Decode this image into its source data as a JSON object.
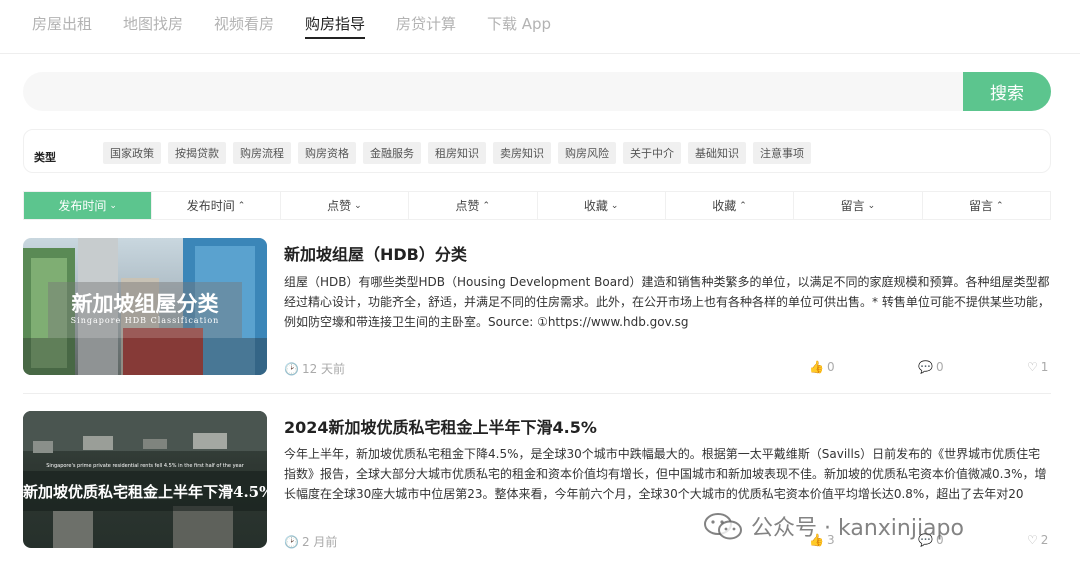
{
  "nav": {
    "items": [
      {
        "label": "房屋出租"
      },
      {
        "label": "地图找房"
      },
      {
        "label": "视频看房"
      },
      {
        "label": "购房指导"
      },
      {
        "label": "房贷计算"
      },
      {
        "label": "下载 App"
      }
    ],
    "active_index": 3
  },
  "search": {
    "placeholder": "",
    "value": "",
    "button_label": "搜索"
  },
  "filter": {
    "type_label": "类型",
    "tags": [
      "国家政策",
      "按揭贷款",
      "购房流程",
      "购房资格",
      "金融服务",
      "租房知识",
      "卖房知识",
      "购房风险",
      "关于中介",
      "基础知识",
      "注意事项"
    ]
  },
  "sort": {
    "tabs": [
      {
        "label": "发布时间",
        "dir": "⌄"
      },
      {
        "label": "发布时间",
        "dir": "⌃"
      },
      {
        "label": "点赞",
        "dir": "⌄"
      },
      {
        "label": "点赞",
        "dir": "⌃"
      },
      {
        "label": "收藏",
        "dir": "⌄"
      },
      {
        "label": "收藏",
        "dir": "⌃"
      },
      {
        "label": "留言",
        "dir": "⌄"
      },
      {
        "label": "留言",
        "dir": "⌃"
      }
    ]
  },
  "articles": [
    {
      "title": "新加坡组屋（HDB）分类",
      "excerpt": "组屋（HDB）有哪些类型HDB（Housing Development Board）建造和销售种类繁多的单位，以满足不同的家庭规模和预算。各种组屋类型都经过精心设计，功能齐全，舒适，并满足不同的住房需求。此外，在公开市场上也有各种各样的单位可供出售。* 转售单位可能不提供某些功能，例如防空壕和带连接卫生间的主卧室。Source: ①https://www.hdb.gov.sg",
      "time": "12 天前",
      "likes": "0",
      "comments": "0",
      "favorites": "1",
      "thumb_title": "新加坡组屋分类",
      "thumb_subtitle": "Singapore HDB Classification"
    },
    {
      "title": "2024新加坡优质私宅租金上半年下滑4.5%",
      "excerpt": "今年上半年，新加坡优质私宅租金下降4.5%，是全球30个城市中跌幅最大的。根据第一太平戴维斯（Savills）日前发布的《世界城市优质住宅指数》报告，全球大部分大城市优质私宅的租金和资本价值均有增长，但中国城市和新加坡表现不佳。新加坡的优质私宅资本价值微减0.3%，增长幅度在全球30座大城市中位居第23。整体来看，今年前六个月，全球30个大城市的优质私宅资本价值平均增长达0.8%，超出了去年对20",
      "time": "2 月前",
      "likes": "3",
      "comments": "0",
      "favorites": "2",
      "thumb_title": "新加坡优质私宅租金上半年下滑4.5%",
      "thumb_subtitle": "Singapore's prime private residential rents fell 4.5% in the first half of the year"
    }
  ],
  "watermark": {
    "text": "公众号 · kanxinjiapo"
  },
  "colors": {
    "accent": "#5cc58e"
  }
}
